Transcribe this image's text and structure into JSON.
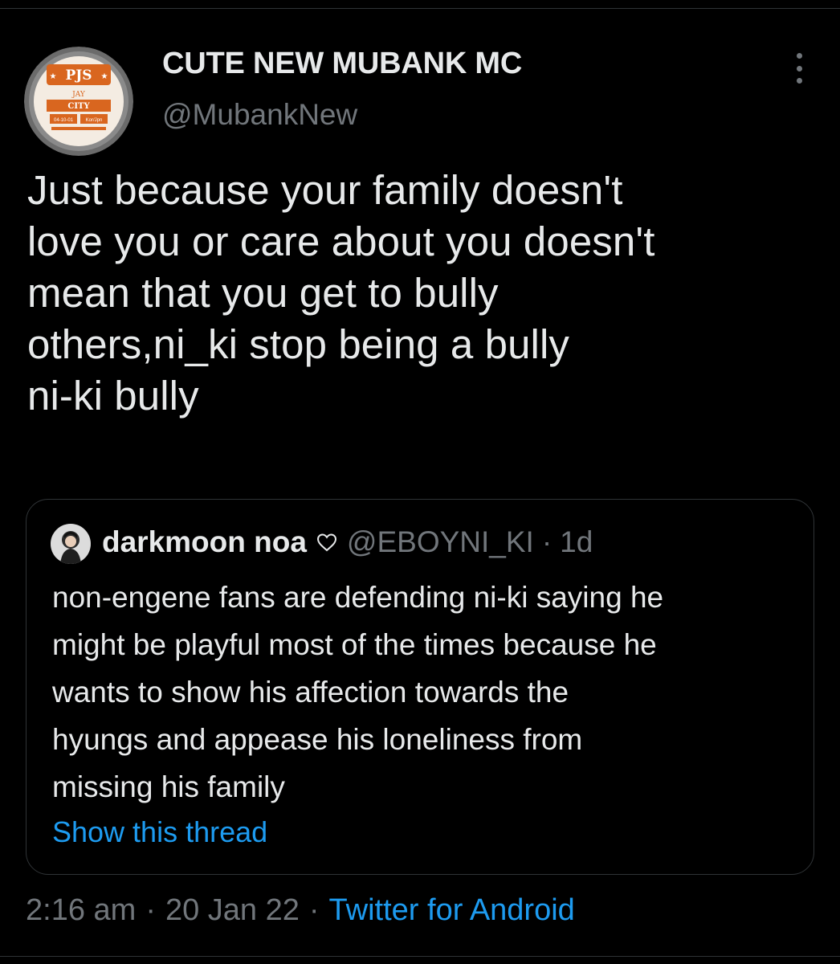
{
  "tweet": {
    "display_name": "CUTE NEW MUBANK MC",
    "handle": "@MubankNew",
    "avatar": {
      "badge_title": "PJS",
      "badge_line1": "JAY",
      "badge_line2": "CITY",
      "badge_line3": "04-10-01",
      "badge_line4": "Kor/Jpn"
    },
    "text": "Just because your family doesn't\nlove you or care about you doesn't\nmean that you get to bully\nothers,ni_ki stop being a bully\nni-ki bully",
    "time": "2:16 am",
    "date": "20 Jan 22",
    "source": "Twitter for Android",
    "separator": "·"
  },
  "quote": {
    "name": "darkmoon noa",
    "heart_icon": "heart-outline-icon",
    "handle": "@EBOYNI_KI",
    "separator": "·",
    "time": "1d",
    "lines": [
      "non-engene fans are defending ni-ki saying he",
      "might be playful most of the times because he",
      "wants to show his affection towards the",
      "hyungs and appease his loneliness from",
      "missing his family"
    ],
    "show_thread": "Show this thread"
  },
  "colors": {
    "background": "#000000",
    "text": "#e7e9ea",
    "muted": "#71767b",
    "accent": "#1d9bf0",
    "border": "#2f3336",
    "badge_orange": "#d9661f"
  }
}
